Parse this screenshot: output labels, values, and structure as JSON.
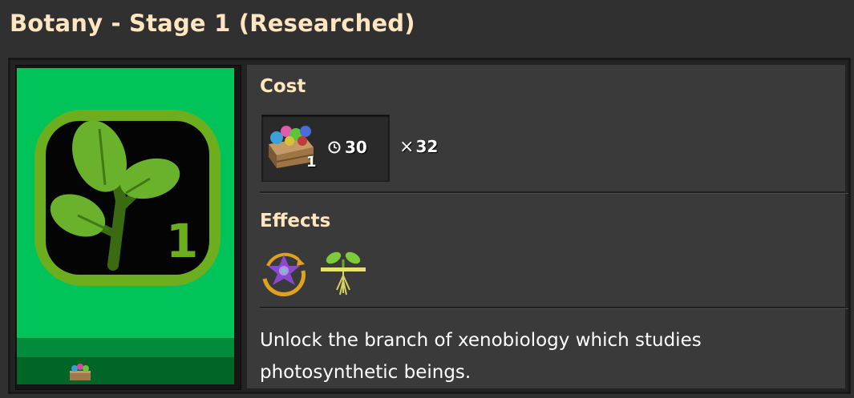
{
  "title": "Botany - Stage 1 (Researched)",
  "technology": {
    "icon": "botany-leaf-icon",
    "stage_number": "1",
    "icon_color": "#00c45a"
  },
  "cost": {
    "heading": "Cost",
    "pack_icon": "flora-crate-icon",
    "pack_count": "1",
    "time_icon": "clock-icon",
    "time": "30",
    "multiplier": "32"
  },
  "effects": {
    "heading": "Effects",
    "items": [
      {
        "icon": "purple-flower-unlock-icon"
      },
      {
        "icon": "sprout-roots-icon"
      }
    ]
  },
  "description": "Unlock the branch of xenobiology which studies photosynthetic beings.",
  "colors": {
    "heading": "#ffe6c0",
    "background": "#313031",
    "panel": "#3a3a3a"
  }
}
